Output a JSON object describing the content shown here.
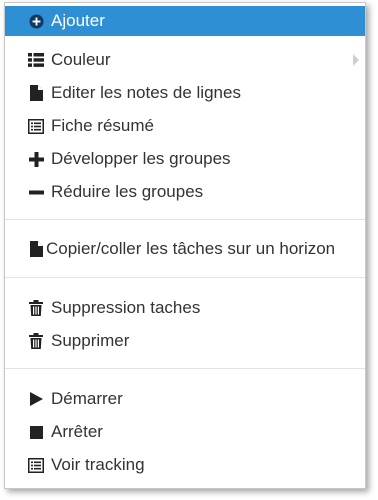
{
  "menu": {
    "items": [
      {
        "label": "Ajouter",
        "icon": "plus-circle-icon"
      },
      {
        "label": "Couleur",
        "icon": "list-icon",
        "has_submenu": true
      },
      {
        "label": "Editer les notes de lignes",
        "icon": "file-icon"
      },
      {
        "label": "Fiche résumé",
        "icon": "list-alt-icon"
      },
      {
        "label": "Développer les groupes",
        "icon": "plus-icon"
      },
      {
        "label": "Réduire les groupes",
        "icon": "minus-icon"
      },
      {
        "label": "Copier/coller les tâches sur un horizon",
        "icon": "file-icon"
      },
      {
        "label": "Suppression taches",
        "icon": "trash-icon"
      },
      {
        "label": "Supprimer",
        "icon": "trash-icon"
      },
      {
        "label": "Démarrer",
        "icon": "play-icon"
      },
      {
        "label": "Arrêter",
        "icon": "stop-icon"
      },
      {
        "label": "Voir tracking",
        "icon": "list-alt-icon"
      }
    ],
    "highlighted_item": "Ajouter"
  },
  "colors": {
    "highlight_bg": "#2f8fd4",
    "highlight_text": "#ffffff",
    "text": "#333333",
    "icon": "#222222",
    "divider": "#e2e2e2",
    "submenu_arrow": "#cfcfcf"
  }
}
